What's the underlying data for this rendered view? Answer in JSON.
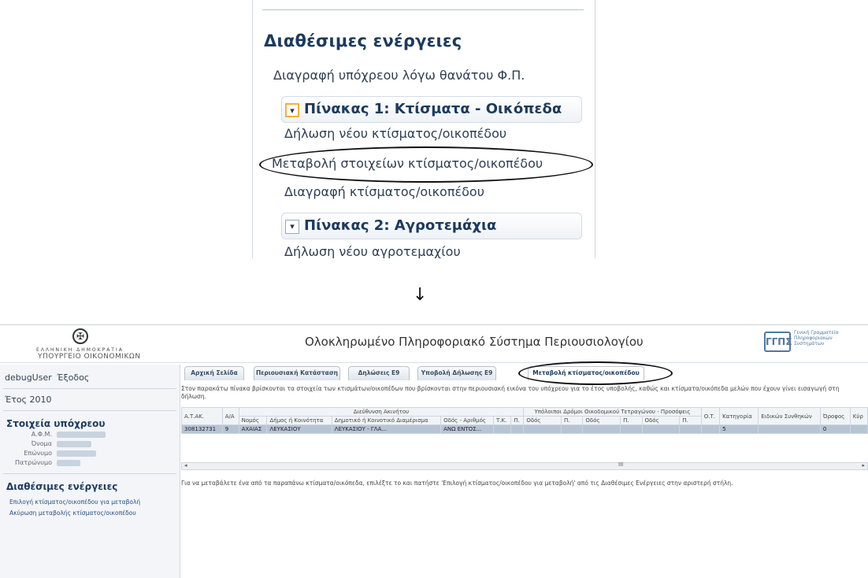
{
  "zoom": {
    "title": "Διαθέσιμες ενέργειες",
    "top_link": "Διαγραφή υπόχρεου λόγω θανάτου Φ.Π.",
    "section1": {
      "title": "Πίνακας 1: Κτίσματα - Οικόπεδα",
      "links": [
        "Δήλωση νέου κτίσματος/οικοπέδου",
        "Μεταβολή στοιχείων κτίσματος/οικοπέδου",
        "Διαγραφή κτίσματος/οικοπέδου"
      ]
    },
    "section2": {
      "title": "Πίνακας 2: Αγροτεμάχια",
      "partial_link": "Δήλωση νέου αγροτεμαχίου"
    },
    "chevron_icon": "chevron-down-icon"
  },
  "arrow": "↓",
  "app": {
    "ministry_small": "ΕΛΛΗΝΙΚΗ ΔΗΜΟΚΡΑΤΙΑ",
    "ministry": "ΥΠΟΥΡΓΕΙΟ ΟΙΚΟΝΟΜΙΚΩΝ",
    "system_title": "Ολοκληρωμένο Πληροφοριακό Σύστημα Περιουσιολογίου",
    "gg_logo": "ΓΓΠΣ",
    "gg_text": "Γενική Γραμματεία Πληροφοριακών Συστημάτων",
    "user": "debugUser",
    "logout": "Έξοδος",
    "year": "Έτος 2010",
    "taxpayer_heading": "Στοιχεία υπόχρεου",
    "taxpayer_fields": [
      "Α.Φ.Μ.",
      "Όνομα",
      "Επώνυμο",
      "Πατρώνυμο"
    ],
    "actions_heading": "Διαθέσιμες ενέργειες",
    "actions": [
      "Επιλογή κτίσματος/οικοπέδου για μεταβολή",
      "Ακύρωση μεταβολής κτίσματος/οικοπέδου"
    ],
    "tabs": [
      "Αρχική Σελίδα",
      "Περιουσιακή Κατάσταση",
      "Δηλώσεις Ε9",
      "Υποβολή Δήλωσης Ε9",
      "Μεταβολή κτίσματος/οικοπέδου"
    ],
    "intro": "Στον παρακάτω πίνακα βρίσκονται τα στοιχεία των κτισμάτων/οικοπέδων που βρίσκονται στην περιουσιακή εικόνα του υπόχρεου για το έτος υποβολής, καθώς και κτίσματα/οικόπεδα μελών που έχουν γίνει εισαγωγή στη δήλωση.",
    "table": {
      "group_address": "Διεύθυνση Ακινήτου",
      "group_roads": "Υπόλοιποι Δρόμοι Οικοδομικού Τετραγώνου - Προσόψεις",
      "col_atak": "Α.Τ.ΑΚ.",
      "col_aa": "Α/Α",
      "cols": [
        "Νομός",
        "Δήμος ή Κοινότητα",
        "Δημοτικό ή Κοινοτικό Διαμέρισμα",
        "Οδός - Αριθμός",
        "Τ.Κ.",
        "Π.",
        "Οδός",
        "Π.",
        "Οδός",
        "Π.",
        "Οδός",
        "Π."
      ],
      "col_ot": "Ο.Τ.",
      "col_cat": "Κατηγορία",
      "col_special": "Ειδικών Συνθηκών",
      "col_floor": "Όροφος",
      "col_kyr": "Κύρ",
      "row": [
        "308132731",
        "9",
        "ΑΧΑΙΑΣ",
        "ΛΕΥΚΑΣΙΟΥ",
        "ΛΕΥΚΑΣΙΟΥ - ΓΛΑ...",
        "ΑΝΩ ΕΝΤΟΣ...",
        "",
        "",
        "",
        "",
        "",
        "",
        "",
        "",
        "",
        "5",
        "",
        "0",
        ""
      ],
      "scroll_mid": "III"
    },
    "hint": "Για να μεταβάλετε ένα από τα παραπάνω κτίσματα/οικόπεδα, επιλέξτε το και πατήστε 'Επιλογή κτίσματος/οικοπέδου για μεταβολή' από τις Διαθέσιμες Ενέργειες στην αριστερή στήλη."
  }
}
